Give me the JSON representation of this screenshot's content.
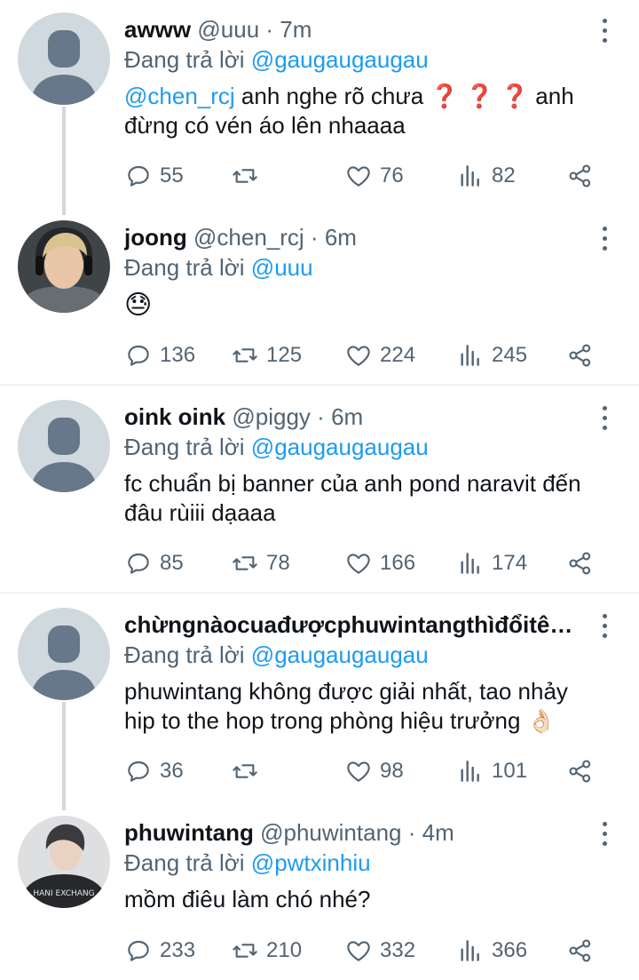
{
  "tweets": [
    {
      "name": "awww",
      "handle": "@uuu",
      "time": "7m",
      "reply_prefix": "Đang trả lời",
      "reply_to": "@gaugaugaugau",
      "body_mention": "@chen_rcj",
      "body_text": " anh nghe rõ  chưa",
      "body_emoji": "❓ ❓ ❓",
      "body_text2": " anh đừng có vén áo lên nhaaaa",
      "replies": "55",
      "retweets": "",
      "likes": "76",
      "views": "82"
    },
    {
      "name": "joong",
      "handle": "@chen_rcj",
      "time": "6m",
      "reply_prefix": "Đang trả lời",
      "reply_to": "@uuu",
      "body_emoji": "😓",
      "replies": "136",
      "retweets": "125",
      "likes": "224",
      "views": "245"
    },
    {
      "name": "oink oink",
      "handle": "@piggy",
      "time": "6m",
      "reply_prefix": "Đang trả lời",
      "reply_to": "@gaugaugaugau",
      "body_text": "fc chuẩn bị banner của anh pond naravit đến đâu rùiii dạaaa",
      "replies": "85",
      "retweets": "78",
      "likes": "166",
      "views": "174"
    },
    {
      "name": "chừngnàocuađượcphuwintangthìđổitê…",
      "handle": "",
      "time": "",
      "reply_prefix": "Đang trả lời",
      "reply_to": "@gaugaugaugau",
      "body_text": "phuwintang không được giải nhất, tao nhảy hip to the hop trong phòng hiệu trưởng",
      "body_emoji": "👌🏻",
      "replies": "36",
      "retweets": "",
      "likes": "98",
      "views": "101"
    },
    {
      "name": "phuwintang",
      "handle": "@phuwintang",
      "time": "4m",
      "reply_prefix": "Đang trả lời",
      "reply_to": "@pwtxinhiu",
      "body_text": "mồm điêu làm chó nhé?",
      "replies": "233",
      "retweets": "210",
      "likes": "332",
      "views": "366"
    }
  ],
  "separator": "·",
  "shirt_text": "HANI EXCHANG",
  "colors": {
    "accent": "#1d9bf0",
    "muted": "#536471",
    "text": "#0f1419",
    "avatar_bg": "#cfd9de",
    "avatar_fg": "#66788a"
  },
  "icons": [
    "reply-icon",
    "retweet-icon",
    "like-icon",
    "views-icon",
    "share-icon",
    "more-icon"
  ]
}
